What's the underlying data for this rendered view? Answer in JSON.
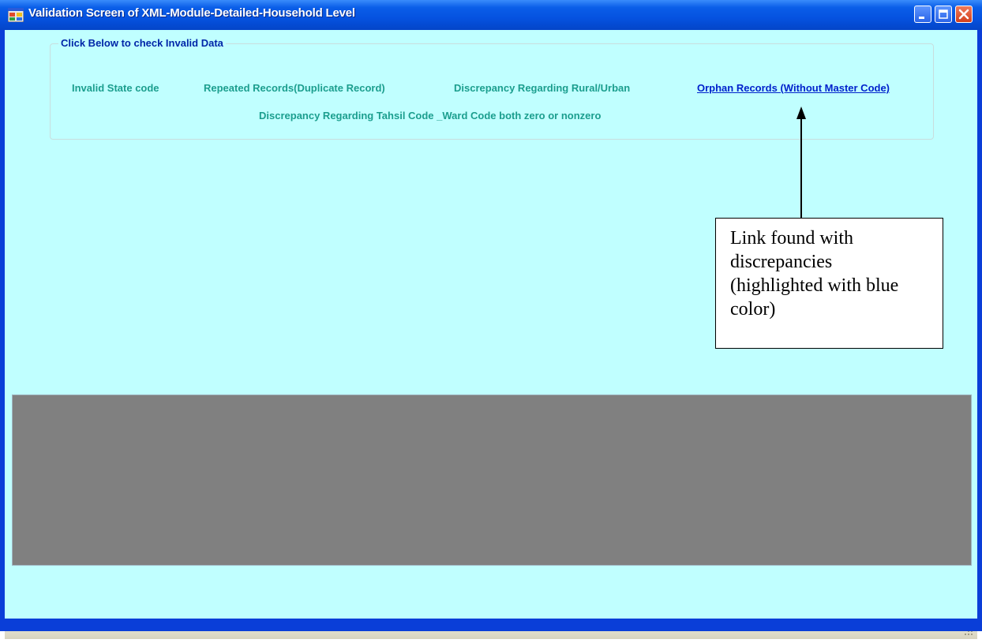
{
  "window": {
    "title": "Validation Screen of XML-Module-Detailed-Household Level",
    "controls": {
      "minimize": "minimize-icon",
      "maximize": "maximize-icon",
      "close": "close-icon"
    }
  },
  "group": {
    "title": "Click Below to check Invalid Data",
    "links": {
      "invalid_state": "Invalid State code",
      "repeated_records": "Repeated Records(Duplicate Record)",
      "rural_urban": "Discrepancy Regarding Rural/Urban",
      "orphan_records": "Orphan Records (Without Master Code)",
      "tahsil_ward": "Discrepancy Regarding Tahsil Code _Ward Code both zero or nonzero"
    },
    "active_link": "orphan_records",
    "colors": {
      "link": "#1b9e8e",
      "active_link": "#0022cc"
    }
  },
  "annotation": {
    "text": "Link found with discrepancies (highlighted with blue color)"
  },
  "colors": {
    "client_bg": "#c0ffff",
    "grid_bg": "#808080",
    "titlebar": "#0552e0"
  }
}
